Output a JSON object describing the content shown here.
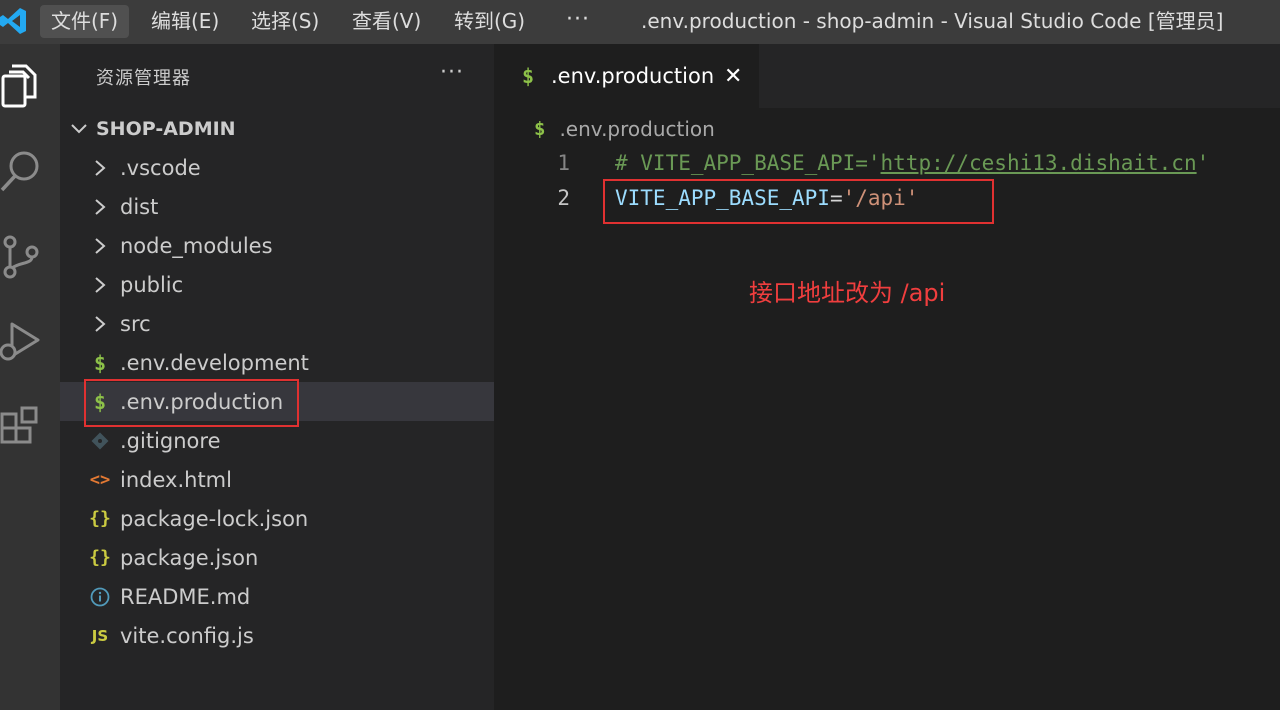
{
  "titlebar": {
    "menu": [
      "文件(F)",
      "编辑(E)",
      "选择(S)",
      "查看(V)",
      "转到(G)"
    ],
    "more": "···",
    "window_title": ".env.production - shop-admin - Visual Studio Code [管理员]"
  },
  "activitybar": {
    "icons": [
      "explorer-icon",
      "search-icon",
      "source-control-icon",
      "run-debug-icon",
      "extensions-icon"
    ]
  },
  "sidebar": {
    "title": "资源管理器",
    "more": "···",
    "root": "SHOP-ADMIN",
    "items": [
      {
        "label": ".vscode",
        "icon": "chevron-right-icon"
      },
      {
        "label": "dist",
        "icon": "chevron-right-icon"
      },
      {
        "label": "node_modules",
        "icon": "chevron-right-icon"
      },
      {
        "label": "public",
        "icon": "chevron-right-icon"
      },
      {
        "label": "src",
        "icon": "chevron-right-icon"
      },
      {
        "label": ".env.development",
        "icon": "dollar-icon"
      },
      {
        "label": ".env.production",
        "icon": "dollar-icon"
      },
      {
        "label": ".gitignore",
        "icon": "git-icon"
      },
      {
        "label": "index.html",
        "icon": "html-icon"
      },
      {
        "label": "package-lock.json",
        "icon": "json-icon"
      },
      {
        "label": "package.json",
        "icon": "json-icon"
      },
      {
        "label": "README.md",
        "icon": "info-icon"
      },
      {
        "label": "vite.config.js",
        "icon": "js-icon"
      }
    ],
    "selected_index": 6
  },
  "editor": {
    "tab": {
      "label": ".env.production",
      "icon": "$",
      "close": "✕"
    },
    "breadcrumb": {
      "icon": "$",
      "label": ".env.production"
    },
    "lines": [
      {
        "number": "1",
        "comment_prefix": "# VITE_APP_BASE_API='",
        "link": "http://ceshi13.dishait.cn",
        "comment_suffix": "'"
      },
      {
        "number": "2",
        "key": "VITE_APP_BASE_API",
        "eq": "=",
        "value": "'/api'"
      }
    ],
    "annotation": "接口地址改为 /api"
  },
  "colors": {
    "highlight_border": "#e03131",
    "env_icon": "#8dc149",
    "comment": "#6a9955",
    "key": "#9cdcfe",
    "string": "#ce9178"
  }
}
